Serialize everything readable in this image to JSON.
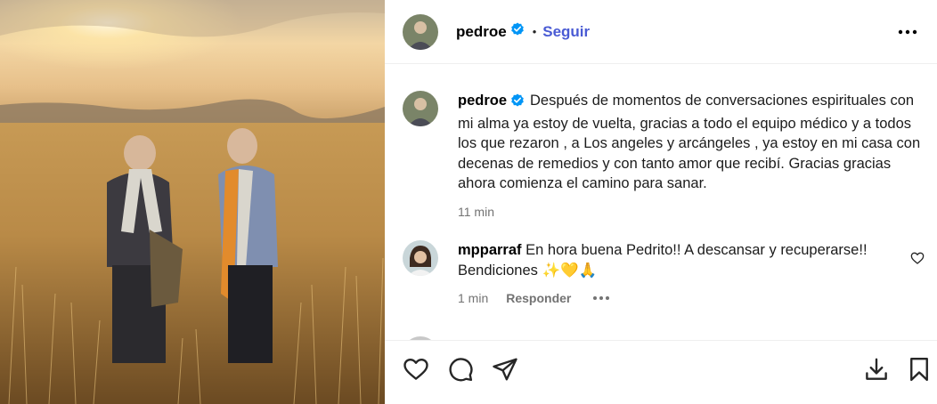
{
  "post": {
    "username": "pedroe",
    "verified": true,
    "follow_label": "Seguir",
    "separator": "•",
    "caption": "Después de momentos de conversaciones espirituales con mi alma ya estoy de vuelta, gracias a todo el equipo médico y a todos los que rezaron , a Los angeles y arcángeles , ya estoy en mi casa con decenas de remedios y con tanto amor que recibí. Gracias gracias ahora comienza el camino para sanar.",
    "caption_time": "11 min"
  },
  "comments": [
    {
      "username": "mpparraf",
      "text": "En hora buena Pedrito!! A descansar y recuperarse!! Bendiciones ✨💛🙏",
      "time": "1 min",
      "reply_label": "Responder"
    }
  ],
  "icons": {
    "more": "more-options-icon",
    "verified": "verified-badge-icon",
    "like": "heart-icon",
    "comment": "comment-icon",
    "share": "paper-plane-icon",
    "download": "download-icon",
    "save": "bookmark-icon"
  },
  "colors": {
    "follow": "#4a5bd4",
    "verified": "#0095f6",
    "muted": "#737373"
  }
}
